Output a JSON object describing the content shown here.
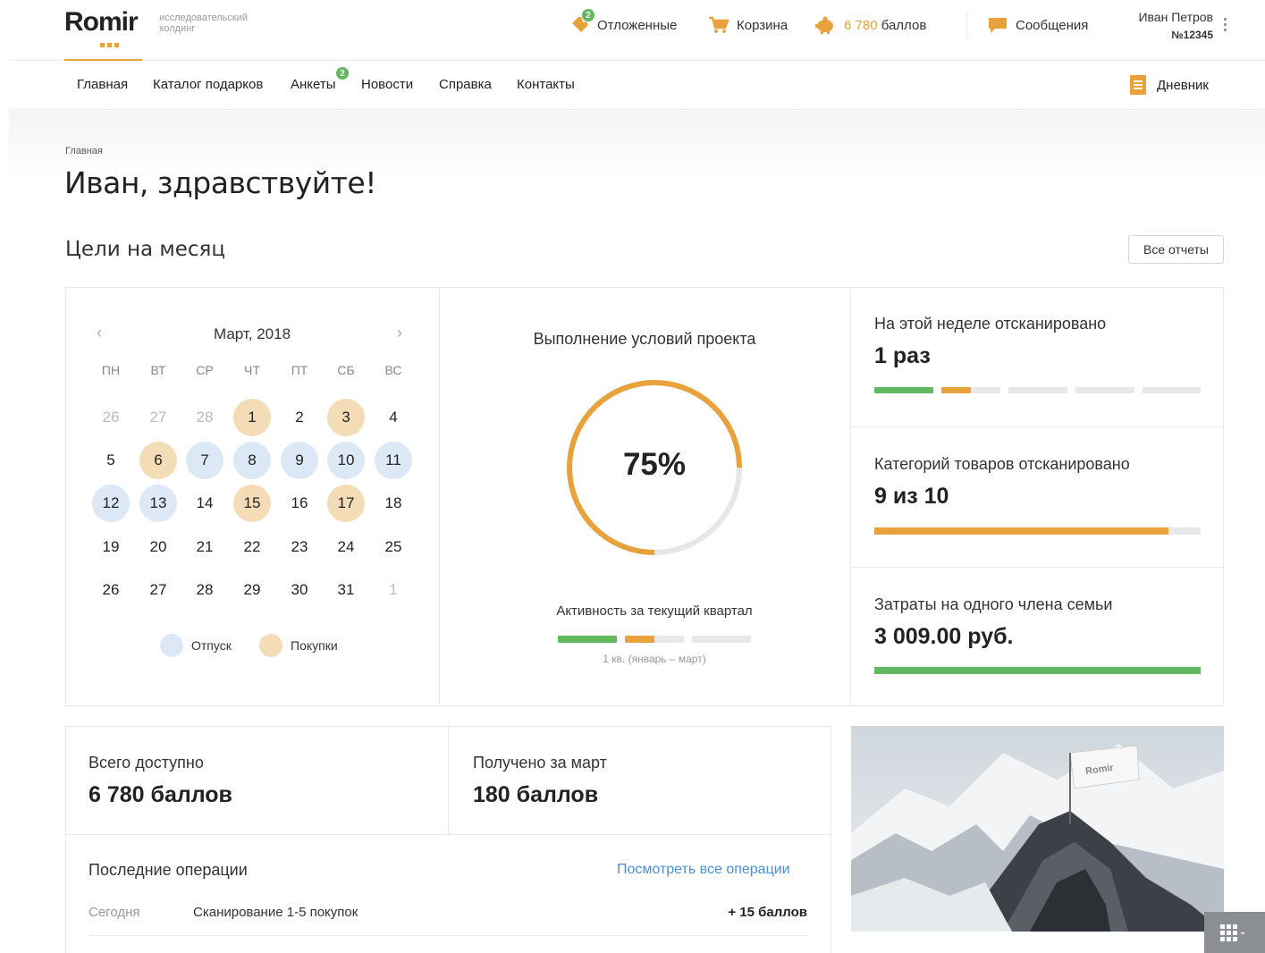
{
  "header": {
    "logo": "Romir",
    "logo_sub": "исследовательский холдинг",
    "deferred_label": "Отложенные",
    "deferred_count": "2",
    "cart_label": "Корзина",
    "points_value": "6 780",
    "points_unit": "баллов",
    "messages_label": "Сообщения",
    "user_name": "Иван Петров",
    "user_id": "№12345"
  },
  "nav": {
    "items": [
      "Главная",
      "Каталог подарков",
      "Анкеты",
      "Новости",
      "Справка",
      "Контакты"
    ],
    "surveys_count": "2",
    "diary_label": "Дневник"
  },
  "breadcrumb": "Главная",
  "page_title": "Иван, здравствуйте!",
  "goals": {
    "title": "Цели на месяц",
    "all_reports": "Все отчеты"
  },
  "calendar": {
    "title": "Март, 2018",
    "weekdays": [
      "ПН",
      "ВТ",
      "СР",
      "ЧТ",
      "ПТ",
      "СБ",
      "ВС"
    ],
    "weeks": [
      [
        {
          "d": "26",
          "t": "other"
        },
        {
          "d": "27",
          "t": "other"
        },
        {
          "d": "28",
          "t": "other"
        },
        {
          "d": "1",
          "t": "buy"
        },
        {
          "d": "2",
          "t": ""
        },
        {
          "d": "3",
          "t": "buy"
        },
        {
          "d": "4",
          "t": ""
        }
      ],
      [
        {
          "d": "5",
          "t": ""
        },
        {
          "d": "6",
          "t": "buy"
        },
        {
          "d": "7",
          "t": "vac"
        },
        {
          "d": "8",
          "t": "vac"
        },
        {
          "d": "9",
          "t": "vac"
        },
        {
          "d": "10",
          "t": "vac"
        },
        {
          "d": "11",
          "t": "vac"
        }
      ],
      [
        {
          "d": "12",
          "t": "vac"
        },
        {
          "d": "13",
          "t": "vac"
        },
        {
          "d": "14",
          "t": ""
        },
        {
          "d": "15",
          "t": "buy"
        },
        {
          "d": "16",
          "t": ""
        },
        {
          "d": "17",
          "t": "buy"
        },
        {
          "d": "18",
          "t": ""
        }
      ],
      [
        {
          "d": "19",
          "t": ""
        },
        {
          "d": "20",
          "t": ""
        },
        {
          "d": "21",
          "t": ""
        },
        {
          "d": "22",
          "t": ""
        },
        {
          "d": "23",
          "t": ""
        },
        {
          "d": "24",
          "t": ""
        },
        {
          "d": "25",
          "t": ""
        }
      ],
      [
        {
          "d": "26",
          "t": ""
        },
        {
          "d": "27",
          "t": ""
        },
        {
          "d": "28",
          "t": ""
        },
        {
          "d": "29",
          "t": ""
        },
        {
          "d": "30",
          "t": ""
        },
        {
          "d": "31",
          "t": ""
        },
        {
          "d": "1",
          "t": "other"
        }
      ]
    ],
    "legend_vacation": "Отпуск",
    "legend_purchases": "Покупки"
  },
  "project": {
    "title": "Выполнение условий проекта",
    "percent": 75,
    "percent_label": "75%",
    "activity_title": "Активность за текущий квартал",
    "activity_sub": "1 кв. (январь – март)"
  },
  "stats": {
    "scanned_week_label": "На этой неделе отсканировано",
    "scanned_week_value": "1 раз",
    "categories_label": "Категорий товаров отсканировано",
    "categories_value": "9 из 10",
    "categories_fraction": 0.9,
    "costs_label": "Затраты на одного члена семьи",
    "costs_value": "3 009.00 руб."
  },
  "balance": {
    "available_label": "Всего доступно",
    "available_value": "6 780 баллов",
    "received_label": "Получено за март",
    "received_value": "180 баллов"
  },
  "operations": {
    "title": "Последние операции",
    "view_all": "Посмотреть все операции",
    "rows": [
      {
        "date": "Сегодня",
        "text": "Сканирование 1-5 покупок",
        "points": "+ 15 баллов"
      }
    ]
  },
  "colors": {
    "accent": "#e8a23c",
    "green": "#62b85f",
    "link": "#4a8fd9"
  }
}
